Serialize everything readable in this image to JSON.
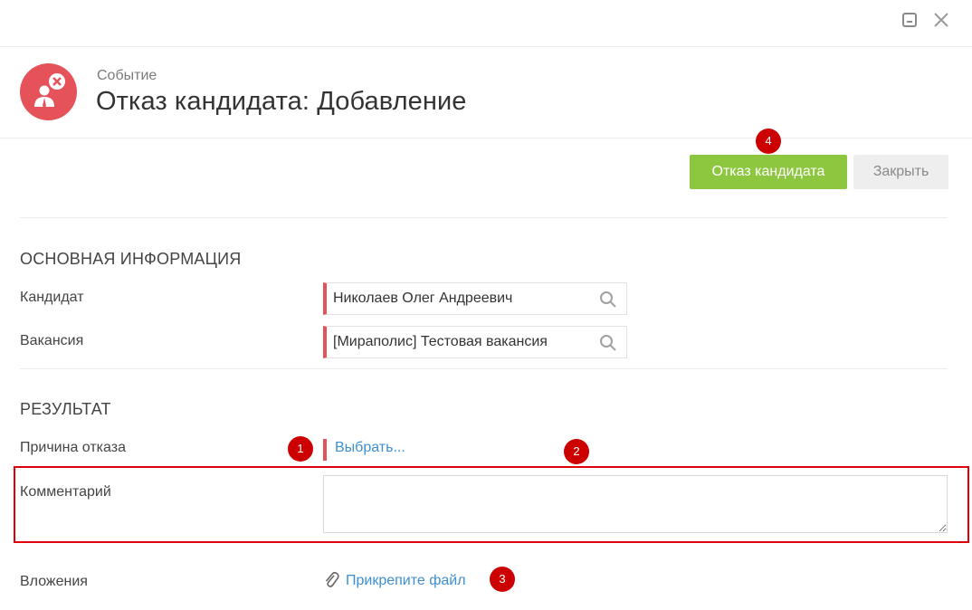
{
  "window": {
    "minimize_icon": "minimize-icon",
    "close_icon": "close-icon"
  },
  "header": {
    "subtitle": "Событие",
    "title": "Отказ кандидата: Добавление",
    "icon": "candidate-reject-icon",
    "icon_color": "#e5525a"
  },
  "toolbar": {
    "primary_label": "Отказ кандидата",
    "secondary_label": "Закрыть",
    "primary_color": "#8dc63f"
  },
  "main_info": {
    "title": "ОСНОВНАЯ ИНФОРМАЦИЯ",
    "candidate_label": "Кандидат",
    "candidate_value": "Николаев Олег Андреевич",
    "vacancy_label": "Вакансия",
    "vacancy_value": "[Мираполис] Тестовая вакансия"
  },
  "result": {
    "title": "РЕЗУЛЬТАТ",
    "reason_label": "Причина отказа",
    "reason_link": "Выбрать...",
    "comment_label": "Комментарий",
    "comment_value": "",
    "attachments_label": "Вложения",
    "attach_link": "Прикрепите файл"
  },
  "annotations": {
    "badge_1": "1",
    "badge_2": "2",
    "badge_3": "3",
    "badge_4": "4",
    "color": "#cc0000"
  },
  "colors": {
    "required_marker": "#e5525a",
    "link": "#3d8fd1",
    "highlight_box": "#e0000a"
  }
}
